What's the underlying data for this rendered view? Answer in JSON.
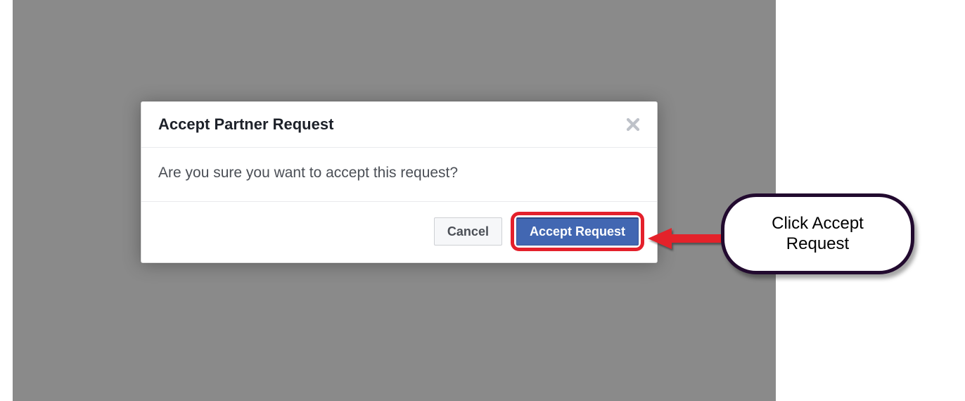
{
  "dialog": {
    "title": "Accept Partner Request",
    "body": "Are you sure you want to accept this request?",
    "cancel_label": "Cancel",
    "accept_label": "Accept Request"
  },
  "annotation": {
    "callout_text": "Click Accept Request"
  }
}
